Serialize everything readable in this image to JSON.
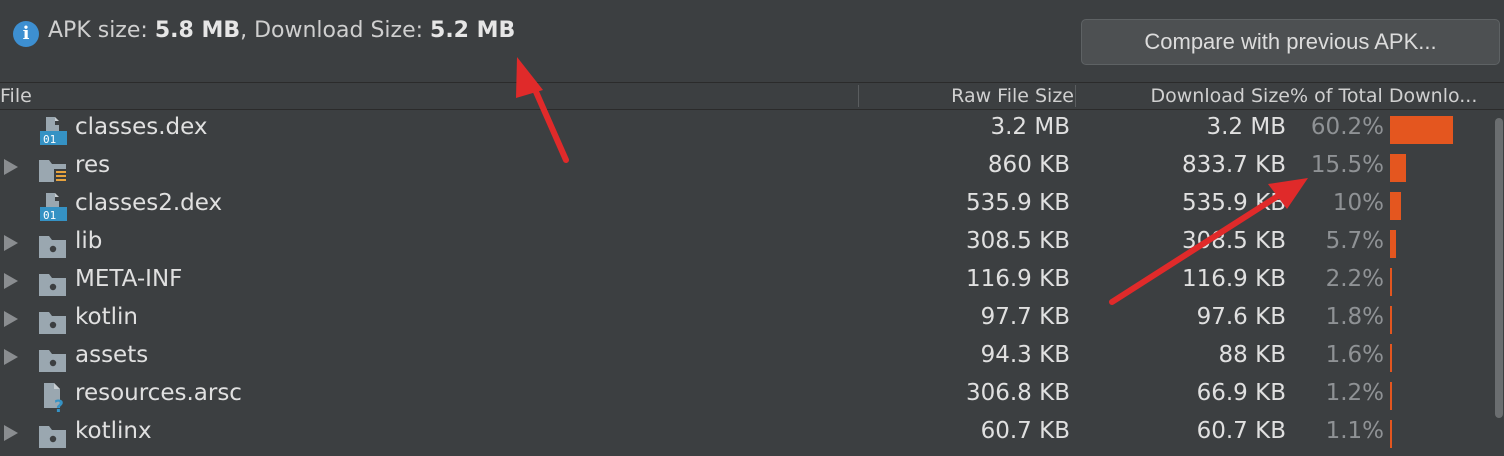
{
  "summary": {
    "apk_label": "APK size: ",
    "apk_value": "5.8 MB",
    "sep": ", Download Size: ",
    "download_value": "5.2 MB"
  },
  "toolbar": {
    "compare_label": "Compare with previous APK..."
  },
  "columns": {
    "file": "File",
    "raw": "Raw File Size",
    "download": "Download Size",
    "percent": "% of Total Downlo..."
  },
  "rows": [
    {
      "name": "classes.dex",
      "raw": "3.2 MB",
      "download": "3.2 MB",
      "percent": "60.2%",
      "pct_value": 60.2,
      "expandable": false,
      "icon": "dex-file-icon"
    },
    {
      "name": "res",
      "raw": "860 KB",
      "download": "833.7 KB",
      "percent": "15.5%",
      "pct_value": 15.5,
      "expandable": true,
      "icon": "resource-folder-icon"
    },
    {
      "name": "classes2.dex",
      "raw": "535.9 KB",
      "download": "535.9 KB",
      "percent": "10%",
      "pct_value": 10,
      "expandable": false,
      "icon": "dex-file-icon"
    },
    {
      "name": "lib",
      "raw": "308.5 KB",
      "download": "308.5 KB",
      "percent": "5.7%",
      "pct_value": 5.7,
      "expandable": true,
      "icon": "folder-icon"
    },
    {
      "name": "META-INF",
      "raw": "116.9 KB",
      "download": "116.9 KB",
      "percent": "2.2%",
      "pct_value": 2.2,
      "expandable": true,
      "icon": "folder-icon"
    },
    {
      "name": "kotlin",
      "raw": "97.7 KB",
      "download": "97.6 KB",
      "percent": "1.8%",
      "pct_value": 1.8,
      "expandable": true,
      "icon": "folder-icon"
    },
    {
      "name": "assets",
      "raw": "94.3 KB",
      "download": "88 KB",
      "percent": "1.6%",
      "pct_value": 1.6,
      "expandable": true,
      "icon": "folder-icon"
    },
    {
      "name": "resources.arsc",
      "raw": "306.8 KB",
      "download": "66.9 KB",
      "percent": "1.2%",
      "pct_value": 1.2,
      "expandable": false,
      "icon": "unknown-file-icon"
    },
    {
      "name": "kotlinx",
      "raw": "60.7 KB",
      "download": "60.7 KB",
      "percent": "1.1%",
      "pct_value": 1.1,
      "expandable": true,
      "icon": "folder-icon"
    }
  ],
  "colors": {
    "background": "#3c3f41",
    "bar": "#e4561f",
    "annotation_arrow": "#e02a2a",
    "info": "#3d8fd1"
  }
}
